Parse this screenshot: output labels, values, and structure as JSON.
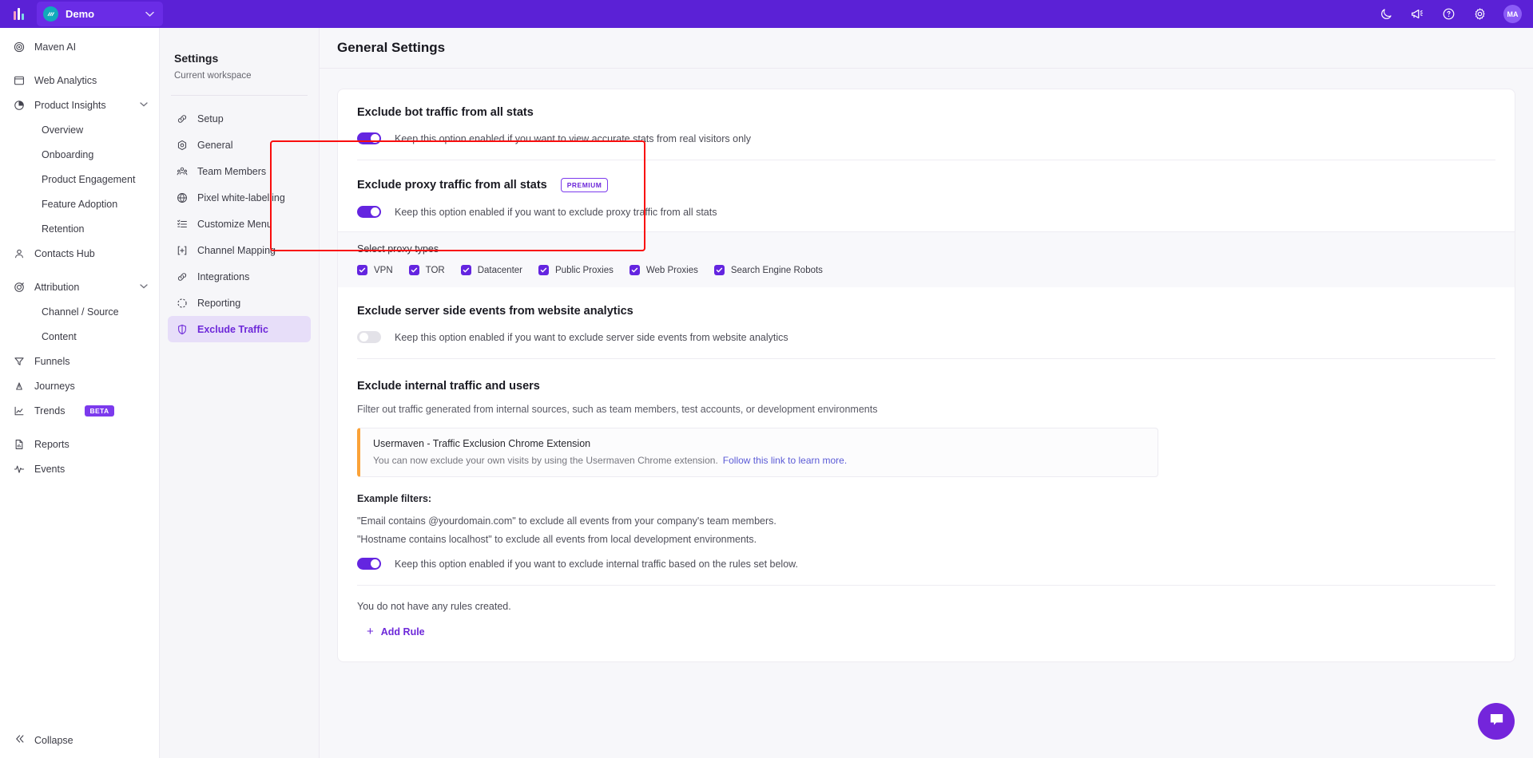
{
  "topbar": {
    "logo_icon": "bar-chart-logo",
    "workspace": {
      "avatar_text": "///",
      "name": "Demo",
      "caret_icon": "chevron-down-icon"
    },
    "icons": [
      {
        "name": "dark-mode-moon-icon"
      },
      {
        "name": "announcements-megaphone-icon"
      },
      {
        "name": "help-question-icon"
      },
      {
        "name": "settings-gear-icon"
      }
    ],
    "user_avatar": "MA"
  },
  "sidebar": {
    "items": [
      {
        "label": "Maven AI",
        "icon": "maven-ai-icon",
        "type": "item"
      },
      {
        "label": "Web Analytics",
        "icon": "web-analytics-icon",
        "type": "item"
      },
      {
        "label": "Product Insights",
        "icon": "product-insights-icon",
        "type": "group",
        "expanded": true
      },
      {
        "label": "Overview",
        "type": "sub"
      },
      {
        "label": "Onboarding",
        "type": "sub"
      },
      {
        "label": "Product Engagement",
        "type": "sub"
      },
      {
        "label": "Feature Adoption",
        "type": "sub"
      },
      {
        "label": "Retention",
        "type": "sub"
      },
      {
        "label": "Contacts Hub",
        "icon": "contacts-hub-icon",
        "type": "item"
      },
      {
        "label": "Attribution",
        "icon": "attribution-icon",
        "type": "group",
        "expanded": true
      },
      {
        "label": "Channel / Source",
        "type": "sub"
      },
      {
        "label": "Content",
        "type": "sub"
      },
      {
        "label": "Funnels",
        "icon": "funnels-icon",
        "type": "item"
      },
      {
        "label": "Journeys",
        "icon": "journeys-icon",
        "type": "item"
      },
      {
        "label": "Trends",
        "icon": "trends-icon",
        "type": "item",
        "badge": "BETA"
      },
      {
        "label": "Reports",
        "icon": "reports-icon",
        "type": "item"
      },
      {
        "label": "Events",
        "icon": "events-icon",
        "type": "item"
      }
    ],
    "collapse": {
      "label": "Collapse",
      "icon": "double-chevron-left-icon"
    }
  },
  "settings_pane": {
    "title": "Settings",
    "subtitle": "Current workspace",
    "items": [
      {
        "label": "Setup",
        "icon": "setup-link-icon",
        "active": false
      },
      {
        "label": "General",
        "icon": "general-gear-icon",
        "active": false
      },
      {
        "label": "Team Members",
        "icon": "team-members-icon",
        "active": false
      },
      {
        "label": "Pixel white-labelling",
        "icon": "globe-icon",
        "active": false
      },
      {
        "label": "Customize Menu",
        "icon": "customize-menu-icon",
        "active": false
      },
      {
        "label": "Channel Mapping",
        "icon": "channel-mapping-icon",
        "active": false
      },
      {
        "label": "Integrations",
        "icon": "integrations-link-icon",
        "active": false
      },
      {
        "label": "Reporting",
        "icon": "reporting-dashed-circle-icon",
        "active": false
      },
      {
        "label": "Exclude Traffic",
        "icon": "shield-icon",
        "active": true
      }
    ]
  },
  "main": {
    "page_title": "General Settings",
    "sections": {
      "bot": {
        "title": "Exclude bot traffic from all stats",
        "toggle_state": "on",
        "toggle_label": "Keep this option enabled if you want to view accurate stats from real visitors only"
      },
      "proxy": {
        "title": "Exclude proxy traffic from all stats",
        "badge": "PREMIUM",
        "toggle_state": "on",
        "toggle_label": "Keep this option enabled if you want to exclude proxy traffic from all stats",
        "proxy_types_label": "Select proxy types",
        "proxy_types": [
          {
            "label": "VPN",
            "checked": true
          },
          {
            "label": "TOR",
            "checked": true
          },
          {
            "label": "Datacenter",
            "checked": true
          },
          {
            "label": "Public Proxies",
            "checked": true
          },
          {
            "label": "Web Proxies",
            "checked": true
          },
          {
            "label": "Search Engine Robots",
            "checked": true
          }
        ],
        "highlight_color": "#f90d0d"
      },
      "server_side": {
        "title": "Exclude server side events from website analytics",
        "toggle_state": "off",
        "toggle_label": "Keep this option enabled if you want to exclude server side events from website analytics"
      },
      "internal": {
        "title": "Exclude internal traffic and users",
        "description": "Filter out traffic generated from internal sources, such as team members, test accounts, or development environments",
        "info_box": {
          "title": "Usermaven - Traffic Exclusion Chrome Extension",
          "text": "You can now exclude your own visits by using the Usermaven Chrome extension.",
          "link": "Follow this link to learn more.",
          "accent_color": "#fba238"
        },
        "examples_title": "Example filters:",
        "examples": [
          "\"Email contains @yourdomain.com\" to exclude all events from your company's team members.",
          "\"Hostname contains localhost\" to exclude all events from local development environments."
        ],
        "toggle_state": "on",
        "toggle_label": "Keep this option enabled if you want to exclude internal traffic based on the rules set below.",
        "no_rules_text": "You do not have any rules created.",
        "add_rule_label": "Add Rule",
        "add_rule_icon": "plus-icon"
      }
    }
  },
  "chat": {
    "icon": "chat-bubble-icon",
    "color": "#7425db"
  }
}
